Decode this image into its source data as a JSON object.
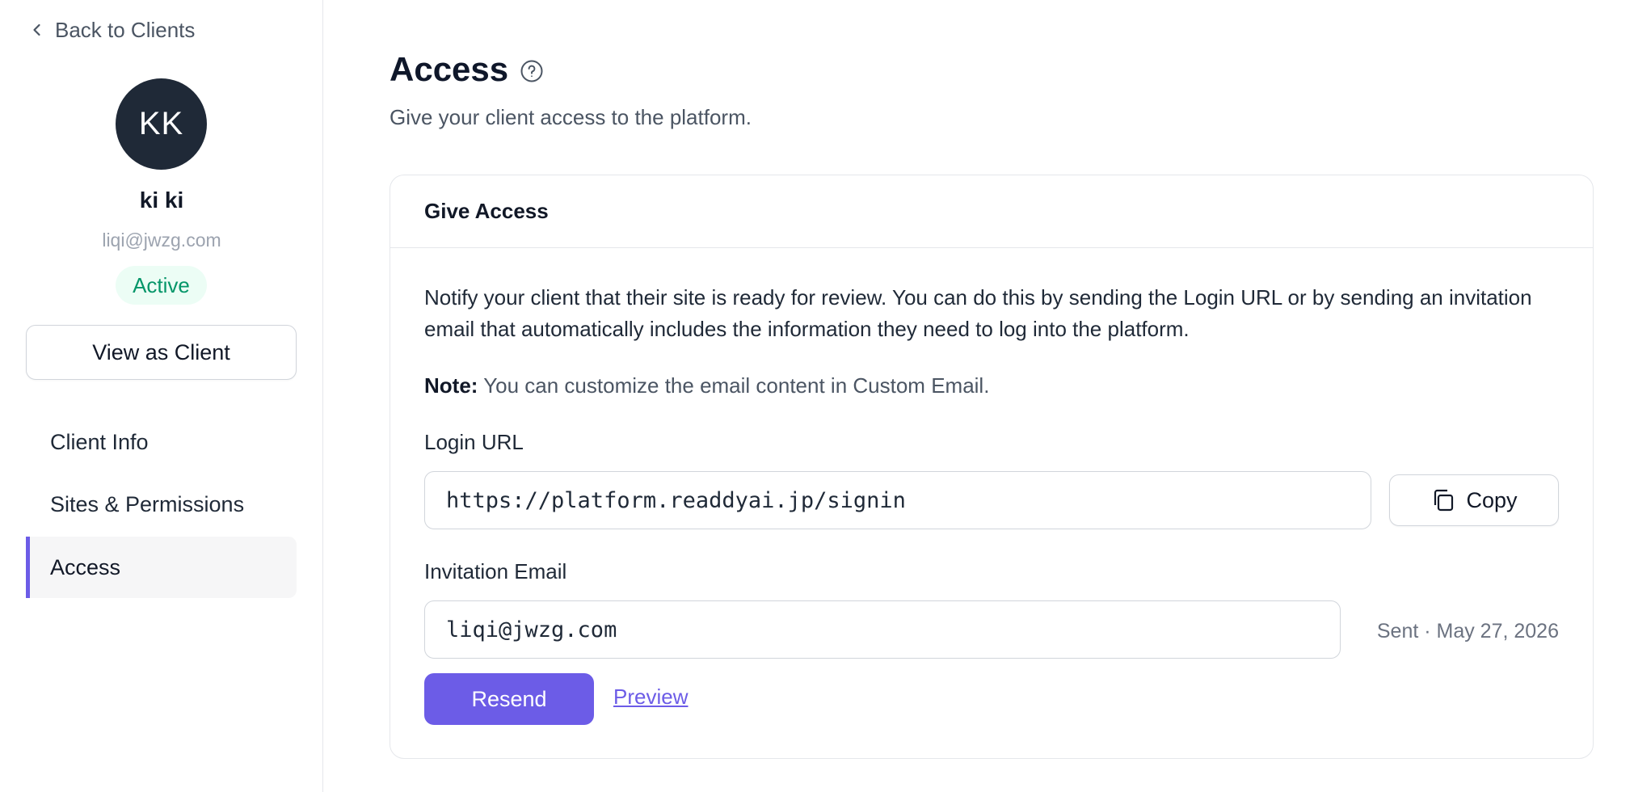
{
  "sidebar": {
    "back_label": "Back to Clients",
    "avatar_initials": "KK",
    "client_name": "ki ki",
    "client_email": "liqi@jwzg.com",
    "status": "Active",
    "view_as_client_label": "View as Client",
    "nav": [
      {
        "label": "Client Info",
        "active": false
      },
      {
        "label": "Sites & Permissions",
        "active": false
      },
      {
        "label": "Access",
        "active": true
      }
    ]
  },
  "main": {
    "title": "Access",
    "subtitle": "Give your client access to the platform.",
    "card": {
      "header": "Give Access",
      "description": "Notify your client that their site is ready for review. You can do this by sending the Login URL or by sending an invitation email that automatically includes the information they need to log into the platform.",
      "note_label": "Note:",
      "note_text": " You can customize the email content in Custom Email.",
      "login_url_label": "Login URL",
      "login_url_value": "https://platform.readdyai.jp/signin",
      "copy_label": "Copy",
      "invitation_email_label": "Invitation Email",
      "invitation_email_value": "liqi@jwzg.com",
      "sent_status": "Sent · May 27, 2026",
      "resend_label": "Resend",
      "preview_label": "Preview"
    }
  },
  "colors": {
    "accent": "#6c5ce7",
    "avatar_bg": "#1f2937",
    "status_text": "#059669",
    "status_bg": "#ecfdf5"
  },
  "icons": {
    "back": "chevron-left-icon",
    "help": "question-circle-icon",
    "copy": "copy-icon"
  }
}
